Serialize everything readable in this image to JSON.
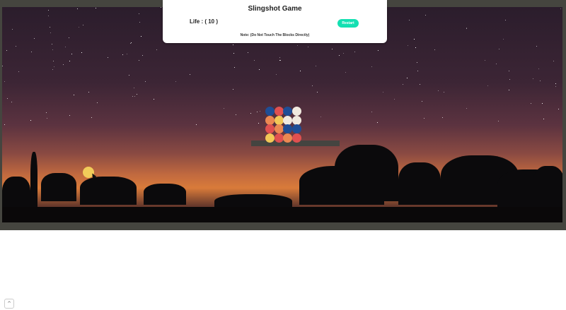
{
  "header": {
    "title": "Slingshot Game",
    "life_text": "Life : ( 10 )",
    "restart_label": "Restart",
    "note": "Note: (Do Not Touch The Blocks Directly)"
  },
  "game": {
    "lives": 10,
    "block_colors": {
      "blue": "#1f4e96",
      "red": "#e05050",
      "cream": "#f1eadf",
      "orange": "#ec8852",
      "yellow": "#f2c857"
    }
  },
  "ui": {
    "scroll_top_icon": "chevron-up-icon"
  }
}
